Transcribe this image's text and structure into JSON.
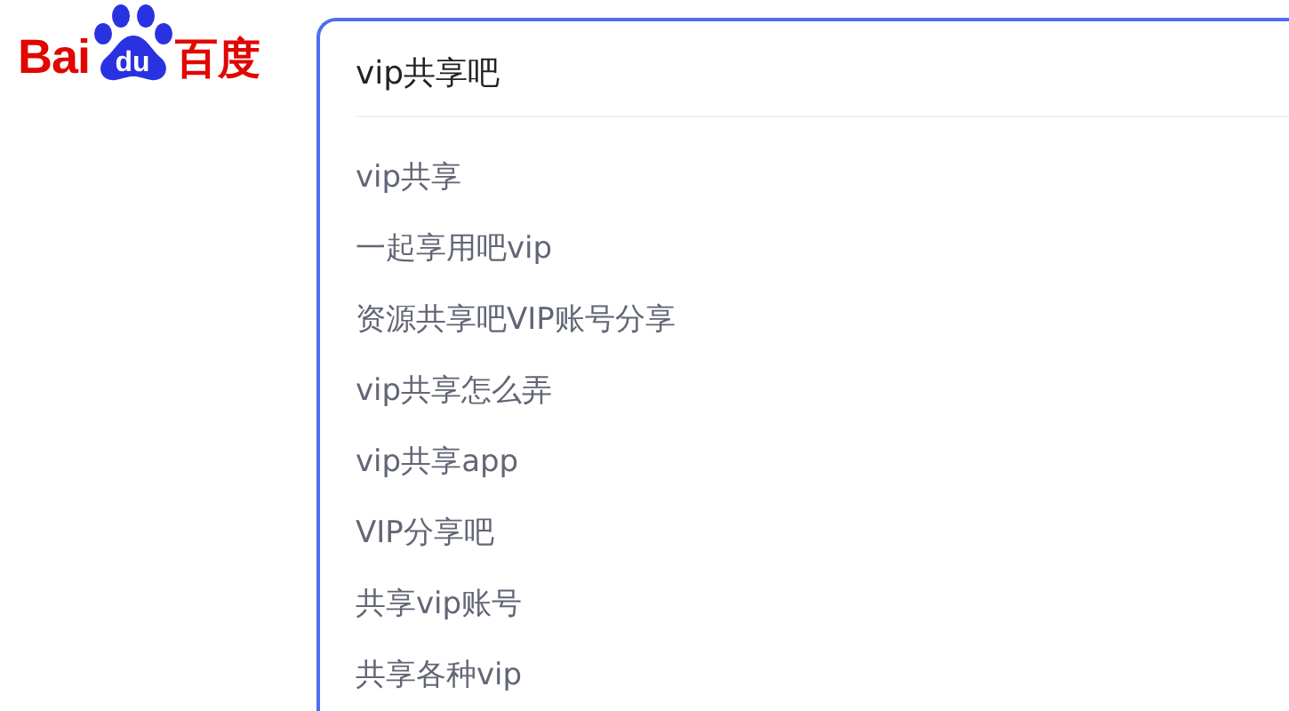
{
  "logo": {
    "left": "Bai",
    "paw": "du",
    "right": "百度"
  },
  "search": {
    "value": "vip共享吧"
  },
  "suggestions": [
    {
      "text": "vip共享"
    },
    {
      "text": "一起享用吧vip"
    },
    {
      "text": "资源共享吧VIP账号分享"
    },
    {
      "text": "vip共享怎么弄"
    },
    {
      "text": "vip共享app"
    },
    {
      "text": "VIP分享吧"
    },
    {
      "text": "共享vip账号"
    },
    {
      "text": "共享各种vip"
    }
  ]
}
